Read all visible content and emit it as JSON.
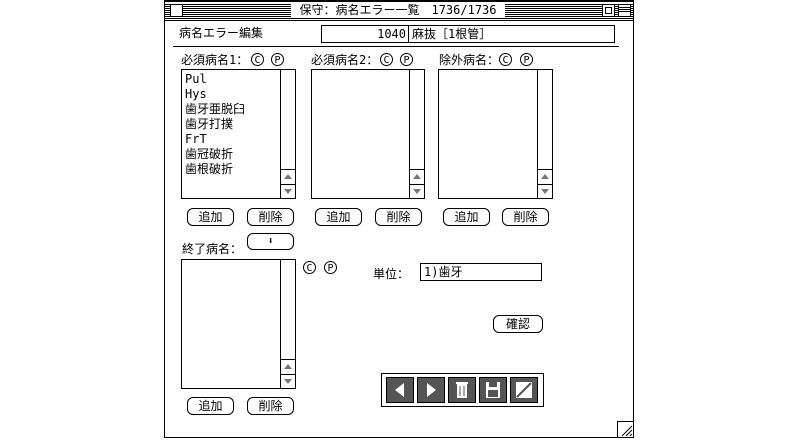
{
  "window": {
    "title": "保守：病名エラー一覧　1736/1736"
  },
  "header": {
    "section_label": "病名エラー編集",
    "record_code": "1040",
    "record_name": "麻抜［1根管］"
  },
  "lists": {
    "required1": {
      "label": "必須病名1：",
      "items": [
        "Pul",
        "Hys",
        "歯牙亜脱臼",
        "歯牙打撲",
        "FrT",
        "歯冠破折",
        "歯根破折"
      ]
    },
    "required2": {
      "label": "必須病名2：",
      "items": []
    },
    "excluded": {
      "label": "除外病名：",
      "items": []
    },
    "finished": {
      "label": "終了病名：",
      "items": []
    }
  },
  "badges": {
    "c": "C",
    "p": "P"
  },
  "buttons": {
    "add": "追加",
    "delete": "削除",
    "confirm": "確認",
    "down_arrow": "⬇"
  },
  "unit": {
    "label": "単位：",
    "value": "1)歯牙"
  },
  "navbar": {
    "icons": [
      "prev-record-icon",
      "next-record-icon",
      "trash-icon",
      "save-icon",
      "cancel-icon"
    ]
  }
}
